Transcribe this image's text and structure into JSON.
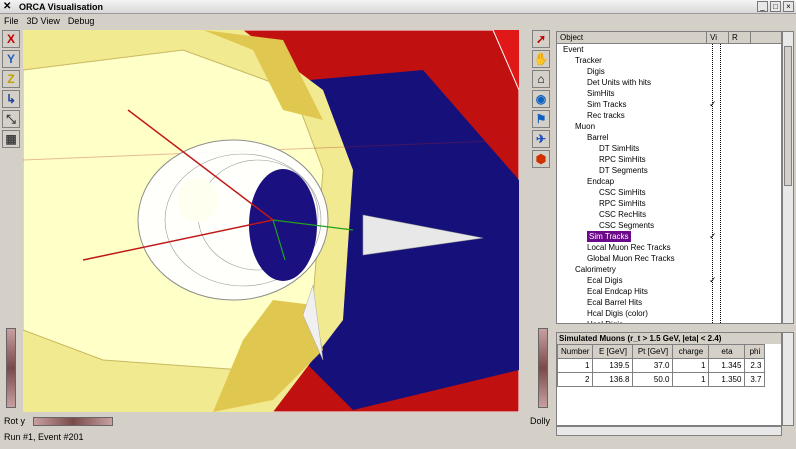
{
  "window": {
    "title": "ORCA Visualisation",
    "minimize": "_",
    "maximize": "□",
    "close": "×"
  },
  "menu": [
    "File",
    "3D View",
    "Debug"
  ],
  "left_tools": [
    {
      "icon": "x-axis-icon",
      "glyph": "X",
      "color": "#c00000"
    },
    {
      "icon": "y-axis-icon",
      "glyph": "Y",
      "color": "#2060c0"
    },
    {
      "icon": "z-axis-icon",
      "glyph": "Z",
      "color": "#c0a000"
    },
    {
      "icon": "axes-icon",
      "glyph": "↳",
      "color": "#2040a0"
    },
    {
      "icon": "axes-alt-icon",
      "glyph": "⤡",
      "color": "#404040"
    },
    {
      "icon": "grid-icon",
      "glyph": "▦",
      "color": "#404040"
    }
  ],
  "right_tools": [
    {
      "icon": "pointer-icon",
      "glyph": "➚",
      "color": "#c00000"
    },
    {
      "icon": "hand-icon",
      "glyph": "✋",
      "color": "#000000"
    },
    {
      "icon": "home-icon",
      "glyph": "⌂",
      "color": "#000000"
    },
    {
      "icon": "view-all-icon",
      "glyph": "◉",
      "color": "#1060c0"
    },
    {
      "icon": "seek-icon",
      "glyph": "⚑",
      "color": "#1060c0"
    },
    {
      "icon": "perspective-icon",
      "glyph": "✈",
      "color": "#2050c0"
    },
    {
      "icon": "render-style-icon",
      "glyph": "⬢",
      "color": "#d03000"
    }
  ],
  "bottom": {
    "left_label": "Rot y",
    "right_label": "Dolly"
  },
  "status": "Run #1, Event #201",
  "tree": {
    "header": [
      "Object",
      "Vi",
      "R"
    ],
    "rows": [
      {
        "indent": 0,
        "label": "Event",
        "checked": false
      },
      {
        "indent": 1,
        "label": "Tracker",
        "checked": false
      },
      {
        "indent": 2,
        "label": "Digis",
        "checked": false
      },
      {
        "indent": 2,
        "label": "Det Units with hits",
        "checked": false
      },
      {
        "indent": 2,
        "label": "SimHits",
        "checked": false
      },
      {
        "indent": 2,
        "label": "Sim Tracks",
        "checked": true
      },
      {
        "indent": 2,
        "label": "Rec tracks",
        "checked": false
      },
      {
        "indent": 1,
        "label": "Muon",
        "checked": false
      },
      {
        "indent": 2,
        "label": "Barrel",
        "checked": false
      },
      {
        "indent": 3,
        "label": "DT SimHits",
        "checked": false
      },
      {
        "indent": 3,
        "label": "RPC SimHits",
        "checked": false
      },
      {
        "indent": 3,
        "label": "DT Segments",
        "checked": false
      },
      {
        "indent": 2,
        "label": "Endcap",
        "checked": false
      },
      {
        "indent": 3,
        "label": "CSC SimHits",
        "checked": false
      },
      {
        "indent": 3,
        "label": "RPC SimHits",
        "checked": false
      },
      {
        "indent": 3,
        "label": "CSC RecHits",
        "checked": false
      },
      {
        "indent": 3,
        "label": "CSC Segments",
        "checked": false
      },
      {
        "indent": 2,
        "label": "Sim Tracks",
        "checked": true,
        "selected": true
      },
      {
        "indent": 2,
        "label": "Local Muon Rec Tracks",
        "checked": false
      },
      {
        "indent": 2,
        "label": "Global Muon Rec Tracks",
        "checked": false
      },
      {
        "indent": 1,
        "label": "Calorimetry",
        "checked": false
      },
      {
        "indent": 2,
        "label": "Ecal Digis",
        "checked": true
      },
      {
        "indent": 2,
        "label": "Ecal Endcap Hits",
        "checked": false
      },
      {
        "indent": 2,
        "label": "Ecal Barrel Hits",
        "checked": false
      },
      {
        "indent": 2,
        "label": "Hcal Digis (color)",
        "checked": false
      },
      {
        "indent": 2,
        "label": "Hcal Digis",
        "checked": false
      }
    ]
  },
  "table": {
    "title": "Simulated Muons (r_t > 1.5 GeV, |eta| < 2.4)",
    "columns": [
      "Number",
      "E [GeV]",
      "Pt [GeV]",
      "charge",
      "eta",
      "phi"
    ],
    "rows": [
      [
        "1",
        "139.5",
        "37.0",
        "1",
        "1.345",
        "2.3"
      ],
      [
        "2",
        "136.8",
        "50.0",
        "1",
        "1.350",
        "3.7"
      ]
    ]
  }
}
